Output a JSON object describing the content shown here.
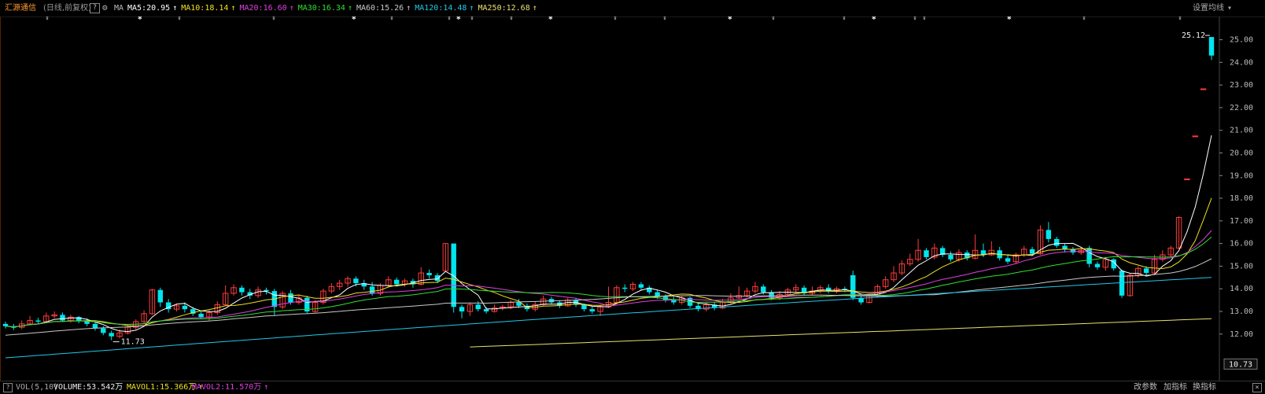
{
  "header": {
    "stock_name": "汇源通信",
    "chart_mode": "(日线,前复权)",
    "help_label": "?",
    "ma_label": "MA",
    "ma_items": [
      {
        "label": "MA5:20.95",
        "color": "#ffffff"
      },
      {
        "label": "MA10:18.14",
        "color": "#f0e020"
      },
      {
        "label": "MA20:16.60",
        "color": "#e040e0"
      },
      {
        "label": "MA30:16.34",
        "color": "#30e030"
      },
      {
        "label": "MA60:15.26",
        "color": "#c8c8c8"
      },
      {
        "label": "MA120:14.48",
        "color": "#20c8e8"
      },
      {
        "label": "MA250:12.68",
        "color": "#e8e070"
      }
    ],
    "up_arrow": "↑",
    "set_ma_label": "设置均线",
    "set_ma_caret": "▾"
  },
  "price_axis": {
    "labels": [
      "25.00",
      "24.00",
      "23.00",
      "22.00",
      "21.00",
      "20.00",
      "19.00",
      "18.00",
      "17.00",
      "16.00",
      "15.00",
      "14.00",
      "13.00",
      "12.00"
    ],
    "current_price": "10.73",
    "high_marker": "25.12",
    "low_marker": "11.73"
  },
  "volume_bar": {
    "help_label": "?",
    "indicator": "VOL(5,10)",
    "volume": "VOLUME:53.542万",
    "mavol1": "MAVOL1:15.366万",
    "mavol2": "MAVOL2:11.570万",
    "mavol1_color": "#f0e020",
    "mavol2_color": "#e040e0",
    "up_arrow": "↑",
    "change_params": "改参数",
    "add_indicator": "加指标",
    "switch_indicator": "换指标",
    "close_label": "×"
  },
  "chart_data": {
    "type": "candlestick",
    "ylim": [
      10.5,
      25.4
    ],
    "candles": [
      [
        12.45,
        12.35,
        12.55,
        12.25
      ],
      [
        12.35,
        12.28,
        12.45,
        12.18
      ],
      [
        12.3,
        12.45,
        12.6,
        12.22
      ],
      [
        12.45,
        12.6,
        12.8,
        12.38
      ],
      [
        12.6,
        12.55,
        12.72,
        12.45
      ],
      [
        12.55,
        12.8,
        12.95,
        12.48
      ],
      [
        12.8,
        12.85,
        13.0,
        12.7
      ],
      [
        12.85,
        12.6,
        12.95,
        12.55
      ],
      [
        12.6,
        12.75,
        12.85,
        12.5
      ],
      [
        12.75,
        12.6,
        12.8,
        12.48
      ],
      [
        12.6,
        12.45,
        12.7,
        12.35
      ],
      [
        12.45,
        12.25,
        12.55,
        12.15
      ],
      [
        12.25,
        12.05,
        12.35,
        11.95
      ],
      [
        12.05,
        11.9,
        12.15,
        11.73
      ],
      [
        11.9,
        12.05,
        12.2,
        11.82
      ],
      [
        12.05,
        12.3,
        12.4,
        11.98
      ],
      [
        12.3,
        12.55,
        12.65,
        12.2
      ],
      [
        12.55,
        12.9,
        13.05,
        12.45
      ],
      [
        12.9,
        13.95,
        14.0,
        12.85
      ],
      [
        13.95,
        13.4,
        14.05,
        13.2
      ],
      [
        13.4,
        13.1,
        13.55,
        12.95
      ],
      [
        13.1,
        13.25,
        13.35,
        13.0
      ],
      [
        13.25,
        13.1,
        13.4,
        12.95
      ],
      [
        13.1,
        12.9,
        13.2,
        12.8
      ],
      [
        12.9,
        12.75,
        13.0,
        12.65
      ],
      [
        12.75,
        12.95,
        13.05,
        12.6
      ],
      [
        12.95,
        13.3,
        13.45,
        12.85
      ],
      [
        13.3,
        13.8,
        14.15,
        13.25
      ],
      [
        13.8,
        14.05,
        14.2,
        13.7
      ],
      [
        14.05,
        13.85,
        14.15,
        13.7
      ],
      [
        13.85,
        13.7,
        14.0,
        13.55
      ],
      [
        13.7,
        13.95,
        14.1,
        13.6
      ],
      [
        13.95,
        13.9,
        14.05,
        13.75
      ],
      [
        13.9,
        13.2,
        14.0,
        12.8
      ],
      [
        13.2,
        13.8,
        13.9,
        13.1
      ],
      [
        13.8,
        13.4,
        13.95,
        13.3
      ],
      [
        13.4,
        13.6,
        13.75,
        13.3
      ],
      [
        13.6,
        13.0,
        13.7,
        12.9
      ],
      [
        13.0,
        13.4,
        13.5,
        12.95
      ],
      [
        13.4,
        13.9,
        14.0,
        13.3
      ],
      [
        13.9,
        14.1,
        14.25,
        13.8
      ],
      [
        14.1,
        14.25,
        14.4,
        13.95
      ],
      [
        14.25,
        14.45,
        14.55,
        14.1
      ],
      [
        14.45,
        14.25,
        14.55,
        14.1
      ],
      [
        14.25,
        14.1,
        14.4,
        13.95
      ],
      [
        14.1,
        13.8,
        14.3,
        13.7
      ],
      [
        13.8,
        14.15,
        14.25,
        13.7
      ],
      [
        14.15,
        14.4,
        14.55,
        14.05
      ],
      [
        14.4,
        14.2,
        14.5,
        14.1
      ],
      [
        14.2,
        14.35,
        14.45,
        14.1
      ],
      [
        14.35,
        14.2,
        14.45,
        14.05
      ],
      [
        14.2,
        14.7,
        14.95,
        14.15
      ],
      [
        14.7,
        14.6,
        14.85,
        14.45
      ],
      [
        14.6,
        14.35,
        14.7,
        14.25
      ],
      [
        14.8,
        16.0,
        16.0,
        14.8
      ],
      [
        16.0,
        13.2,
        16.0,
        12.95
      ],
      [
        13.2,
        13.0,
        13.3,
        12.7
      ],
      [
        13.0,
        13.3,
        13.4,
        12.8
      ],
      [
        13.3,
        13.1,
        13.45,
        13.0
      ],
      [
        13.1,
        13.0,
        13.2,
        12.9
      ],
      [
        13.0,
        13.15,
        13.3,
        12.95
      ],
      [
        13.15,
        13.2,
        13.3,
        13.05
      ],
      [
        13.2,
        13.4,
        13.5,
        13.1
      ],
      [
        13.4,
        13.25,
        13.55,
        13.15
      ],
      [
        13.25,
        13.1,
        13.35,
        13.0
      ],
      [
        13.1,
        13.3,
        13.45,
        13.0
      ],
      [
        13.3,
        13.55,
        13.7,
        13.25
      ],
      [
        13.55,
        13.4,
        13.65,
        13.3
      ],
      [
        13.4,
        13.25,
        13.5,
        13.15
      ],
      [
        13.25,
        13.5,
        13.6,
        13.2
      ],
      [
        13.5,
        13.3,
        13.6,
        13.2
      ],
      [
        13.3,
        13.1,
        13.35,
        13.0
      ],
      [
        13.1,
        13.0,
        13.2,
        12.9
      ],
      [
        13.0,
        13.2,
        13.3,
        12.8
      ],
      [
        13.2,
        13.4,
        14.1,
        13.15
      ],
      [
        13.4,
        14.05,
        14.15,
        13.35
      ],
      [
        14.05,
        14.0,
        14.2,
        13.85
      ],
      [
        14.0,
        14.2,
        14.3,
        13.9
      ],
      [
        14.2,
        14.05,
        14.3,
        13.95
      ],
      [
        14.05,
        13.85,
        14.15,
        13.75
      ],
      [
        13.85,
        13.65,
        13.95,
        13.55
      ],
      [
        13.65,
        13.5,
        13.75,
        13.4
      ],
      [
        13.5,
        13.4,
        13.65,
        13.3
      ],
      [
        13.4,
        13.6,
        13.7,
        13.3
      ],
      [
        13.6,
        13.25,
        13.65,
        13.15
      ],
      [
        13.25,
        13.1,
        13.35,
        13.0
      ],
      [
        13.1,
        13.3,
        13.4,
        13.0
      ],
      [
        13.3,
        13.15,
        13.4,
        13.05
      ],
      [
        13.15,
        13.4,
        13.55,
        13.1
      ],
      [
        13.4,
        13.6,
        13.8,
        13.35
      ],
      [
        13.6,
        13.7,
        14.1,
        13.55
      ],
      [
        13.7,
        13.9,
        14.05,
        13.6
      ],
      [
        13.9,
        14.1,
        14.3,
        13.8
      ],
      [
        14.1,
        13.85,
        14.2,
        13.75
      ],
      [
        13.85,
        13.6,
        13.95,
        13.5
      ],
      [
        13.6,
        13.75,
        13.9,
        13.5
      ],
      [
        13.75,
        13.95,
        14.05,
        13.65
      ],
      [
        13.95,
        14.05,
        14.2,
        13.85
      ],
      [
        14.05,
        13.8,
        14.15,
        13.7
      ],
      [
        13.8,
        13.9,
        14.1,
        13.7
      ],
      [
        13.9,
        14.05,
        14.15,
        13.8
      ],
      [
        14.05,
        13.9,
        14.2,
        13.8
      ],
      [
        13.9,
        14.0,
        14.1,
        13.8
      ],
      [
        14.0,
        13.95,
        14.1,
        13.85
      ],
      [
        14.6,
        13.6,
        14.8,
        13.5
      ],
      [
        13.6,
        13.4,
        13.7,
        13.3
      ],
      [
        13.4,
        13.7,
        13.8,
        13.35
      ],
      [
        13.7,
        14.1,
        14.2,
        13.6
      ],
      [
        14.1,
        14.4,
        14.55,
        14.0
      ],
      [
        14.4,
        14.7,
        15.0,
        14.3
      ],
      [
        14.7,
        15.1,
        15.25,
        14.6
      ],
      [
        15.1,
        15.3,
        15.55,
        15.0
      ],
      [
        15.3,
        15.7,
        16.2,
        15.2
      ],
      [
        15.7,
        15.4,
        15.8,
        15.3
      ],
      [
        15.4,
        15.8,
        16.0,
        15.3
      ],
      [
        15.8,
        15.5,
        15.9,
        15.4
      ],
      [
        15.5,
        15.3,
        15.65,
        15.2
      ],
      [
        15.3,
        15.6,
        15.75,
        15.2
      ],
      [
        15.6,
        15.35,
        15.7,
        15.25
      ],
      [
        15.35,
        15.7,
        16.4,
        15.3
      ],
      [
        15.7,
        15.5,
        16.0,
        15.4
      ],
      [
        15.5,
        15.7,
        16.1,
        15.45
      ],
      [
        15.7,
        15.35,
        15.85,
        15.25
      ],
      [
        15.35,
        15.2,
        15.5,
        15.1
      ],
      [
        15.2,
        15.5,
        15.6,
        15.1
      ],
      [
        15.5,
        15.75,
        15.9,
        15.4
      ],
      [
        15.75,
        15.55,
        15.85,
        15.45
      ],
      [
        15.55,
        16.6,
        16.8,
        15.5
      ],
      [
        16.6,
        16.2,
        16.95,
        16.05
      ],
      [
        16.2,
        15.9,
        16.3,
        15.8
      ],
      [
        15.9,
        15.75,
        16.0,
        15.6
      ],
      [
        15.75,
        15.6,
        15.85,
        15.5
      ],
      [
        15.6,
        15.7,
        15.8,
        15.5
      ],
      [
        15.8,
        15.1,
        15.9,
        14.95
      ],
      [
        15.1,
        14.95,
        15.2,
        14.85
      ],
      [
        14.95,
        15.3,
        15.4,
        14.8
      ],
      [
        15.3,
        14.9,
        15.35,
        14.8
      ],
      [
        14.8,
        13.7,
        14.85,
        13.6
      ],
      [
        13.7,
        14.6,
        14.7,
        13.65
      ],
      [
        14.6,
        14.9,
        15.0,
        14.5
      ],
      [
        14.9,
        14.7,
        15.0,
        14.6
      ],
      [
        14.7,
        15.3,
        15.5,
        14.65
      ],
      [
        15.3,
        15.5,
        15.7,
        15.2
      ],
      [
        15.5,
        15.8,
        15.9,
        15.4
      ],
      [
        15.8,
        17.15,
        17.2,
        15.75
      ],
      [
        18.85,
        18.85,
        18.85,
        18.85
      ],
      [
        20.75,
        20.75,
        20.75,
        20.75
      ],
      [
        22.83,
        22.83,
        22.83,
        22.83
      ],
      [
        25.12,
        24.3,
        25.12,
        24.1
      ]
    ]
  }
}
